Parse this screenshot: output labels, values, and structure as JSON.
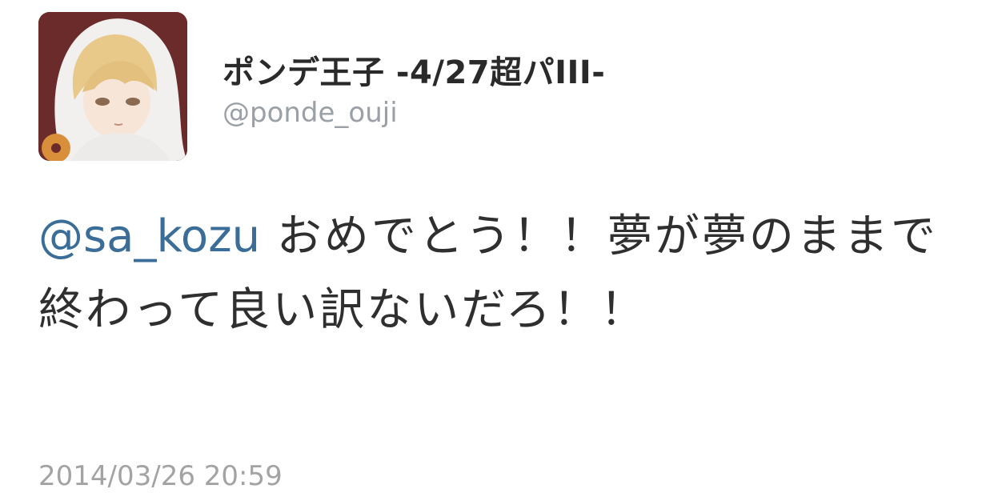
{
  "author": {
    "display_name": "ポンデ王子 -4/27超パIII-",
    "handle": "@ponde_ouji",
    "avatar_icon": "user-avatar-icon"
  },
  "tweet": {
    "mention": "@sa_kozu",
    "text": "おめでとう！！夢が夢のままで終わって良い訳ないだろ！！",
    "timestamp": "2014/03/26 20:59"
  },
  "colors": {
    "mention": "#3a6e99",
    "handle": "#9aa0a6",
    "timestamp": "#a3a3a3"
  }
}
